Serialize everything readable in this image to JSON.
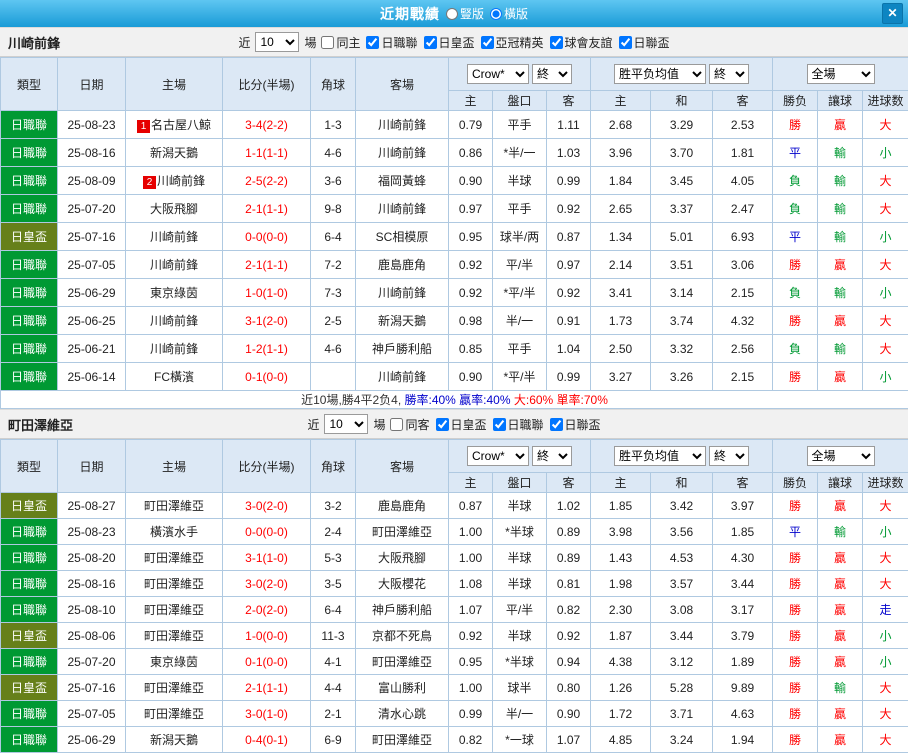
{
  "window": {
    "title": "近期戰績",
    "layout_options": [
      {
        "label": "豎版",
        "selected": false
      },
      {
        "label": "橫版",
        "selected": true
      }
    ],
    "close_icon": "✕"
  },
  "filters": {
    "near_label": "近",
    "match_count": "10",
    "games_label": "場"
  },
  "columns": {
    "type": "類型",
    "date": "日期",
    "home": "主場",
    "score": "比分(半場)",
    "corner": "角球",
    "away": "客場",
    "odds_source": "Crow*",
    "end_label": "終",
    "europe_label": "胜平负均值",
    "scope_label": "全場",
    "sub_home": "主",
    "sub_handicap": "盤口",
    "sub_away": "客",
    "sub_draw": "和",
    "sub_result": "勝负",
    "sub_handicap_result": "讓球",
    "sub_goals": "进球数"
  },
  "colors": {
    "league_green": "#009933",
    "cup_olive": "#66801a",
    "focal_team": "#009933",
    "score_red": "#ff0000",
    "win_red": "#ff0000",
    "draw_blue": "#0000cc",
    "lose_green": "#009933",
    "badge_red": "#e60000"
  },
  "type_colors": {
    "日職聯": "#009933",
    "日皇盃": "#66801a"
  },
  "result_classes": {
    "勝": "r-win",
    "平": "r-draw",
    "負": "r-lose",
    "贏": "r-win",
    "輸": "r-lose",
    "走": "r-draw",
    "大": "r-win",
    "小": "r-lose"
  },
  "sections": [
    {
      "team": "川崎前鋒",
      "checkboxes": [
        {
          "label": "同主",
          "checked": false
        },
        {
          "label": "日職聯",
          "checked": true
        },
        {
          "label": "日皇盃",
          "checked": true
        },
        {
          "label": "亞冠精英",
          "checked": true
        },
        {
          "label": "球會友誼",
          "checked": true
        },
        {
          "label": "日聯盃",
          "checked": true
        }
      ],
      "rows": [
        {
          "type": "日職聯",
          "date": "25-08-23",
          "home": "名古屋八鯨",
          "home_badge": "1",
          "home_focal": false,
          "score": "3-4(2-2)",
          "corner": "1-3",
          "away": "川崎前鋒",
          "away_focal": true,
          "ah_home": "0.79",
          "handicap": "平手",
          "ah_away": "1.11",
          "odds_home": "2.68",
          "odds_draw": "3.29",
          "odds_away": "2.53",
          "result": "勝",
          "handicap_result": "贏",
          "goals_result": "大"
        },
        {
          "type": "日職聯",
          "date": "25-08-16",
          "home": "新潟天鵝",
          "home_badge": "",
          "home_focal": false,
          "score": "1-1(1-1)",
          "corner": "4-6",
          "away": "川崎前鋒",
          "away_focal": true,
          "ah_home": "0.86",
          "handicap": "*半/一",
          "ah_away": "1.03",
          "odds_home": "3.96",
          "odds_draw": "3.70",
          "odds_away": "1.81",
          "result": "平",
          "handicap_result": "輸",
          "goals_result": "小"
        },
        {
          "type": "日職聯",
          "date": "25-08-09",
          "home": "川崎前鋒",
          "home_badge": "2",
          "home_focal": true,
          "score": "2-5(2-2)",
          "corner": "3-6",
          "away": "福岡黃蜂",
          "away_focal": false,
          "ah_home": "0.90",
          "handicap": "半球",
          "ah_away": "0.99",
          "odds_home": "1.84",
          "odds_draw": "3.45",
          "odds_away": "4.05",
          "result": "負",
          "handicap_result": "輸",
          "goals_result": "大"
        },
        {
          "type": "日職聯",
          "date": "25-07-20",
          "home": "大阪飛腳",
          "home_badge": "",
          "home_focal": false,
          "score": "2-1(1-1)",
          "corner": "9-8",
          "away": "川崎前鋒",
          "away_focal": true,
          "ah_home": "0.97",
          "handicap": "平手",
          "ah_away": "0.92",
          "odds_home": "2.65",
          "odds_draw": "3.37",
          "odds_away": "2.47",
          "result": "負",
          "handicap_result": "輸",
          "goals_result": "大"
        },
        {
          "type": "日皇盃",
          "date": "25-07-16",
          "home": "川崎前鋒",
          "home_badge": "",
          "home_focal": true,
          "score": "0-0(0-0)",
          "corner": "6-4",
          "away": "SC相模原",
          "away_focal": false,
          "ah_home": "0.95",
          "handicap": "球半/两",
          "ah_away": "0.87",
          "odds_home": "1.34",
          "odds_draw": "5.01",
          "odds_away": "6.93",
          "result": "平",
          "handicap_result": "輸",
          "goals_result": "小"
        },
        {
          "type": "日職聯",
          "date": "25-07-05",
          "home": "川崎前鋒",
          "home_badge": "",
          "home_focal": true,
          "score": "2-1(1-1)",
          "corner": "7-2",
          "away": "鹿島鹿角",
          "away_focal": false,
          "ah_home": "0.92",
          "handicap": "平/半",
          "ah_away": "0.97",
          "odds_home": "2.14",
          "odds_draw": "3.51",
          "odds_away": "3.06",
          "result": "勝",
          "handicap_result": "贏",
          "goals_result": "大"
        },
        {
          "type": "日職聯",
          "date": "25-06-29",
          "home": "東京綠茵",
          "home_badge": "",
          "home_focal": false,
          "score": "1-0(1-0)",
          "corner": "7-3",
          "away": "川崎前鋒",
          "away_focal": true,
          "ah_home": "0.92",
          "handicap": "*平/半",
          "ah_away": "0.92",
          "odds_home": "3.41",
          "odds_draw": "3.14",
          "odds_away": "2.15",
          "result": "負",
          "handicap_result": "輸",
          "goals_result": "小"
        },
        {
          "type": "日職聯",
          "date": "25-06-25",
          "home": "川崎前鋒",
          "home_badge": "",
          "home_focal": true,
          "score": "3-1(2-0)",
          "corner": "2-5",
          "away": "新潟天鵝",
          "away_focal": false,
          "ah_home": "0.98",
          "handicap": "半/一",
          "ah_away": "0.91",
          "odds_home": "1.73",
          "odds_draw": "3.74",
          "odds_away": "4.32",
          "result": "勝",
          "handicap_result": "贏",
          "goals_result": "大"
        },
        {
          "type": "日職聯",
          "date": "25-06-21",
          "home": "川崎前鋒",
          "home_badge": "",
          "home_focal": true,
          "score": "1-2(1-1)",
          "corner": "4-6",
          "away": "神戶勝利船",
          "away_focal": false,
          "ah_home": "0.85",
          "handicap": "平手",
          "ah_away": "1.04",
          "odds_home": "2.50",
          "odds_draw": "3.32",
          "odds_away": "2.56",
          "result": "負",
          "handicap_result": "輸",
          "goals_result": "大"
        },
        {
          "type": "日職聯",
          "date": "25-06-14",
          "home": "FC橫濱",
          "home_badge": "",
          "home_focal": false,
          "score": "0-1(0-0)",
          "corner": "",
          "away": "川崎前鋒",
          "away_focal": true,
          "ah_home": "0.90",
          "handicap": "*平/半",
          "ah_away": "0.99",
          "odds_home": "3.27",
          "odds_draw": "3.26",
          "odds_away": "2.15",
          "result": "勝",
          "handicap_result": "贏",
          "goals_result": "小"
        }
      ],
      "summary_segments": [
        {
          "text": "近10場,勝4平2负4, ",
          "color": "#333333"
        },
        {
          "text": "勝率:40%",
          "color": "#0000cc"
        },
        {
          "text": " 贏率:40%",
          "color": "#0000cc"
        },
        {
          "text": " 大:60%",
          "color": "#ff0000"
        },
        {
          "text": " 單率:70%",
          "color": "#ff0000"
        }
      ]
    },
    {
      "team": "町田澤維亞",
      "checkboxes": [
        {
          "label": "同客",
          "checked": false
        },
        {
          "label": "日皇盃",
          "checked": true
        },
        {
          "label": "日職聯",
          "checked": true
        },
        {
          "label": "日聯盃",
          "checked": true
        }
      ],
      "rows": [
        {
          "type": "日皇盃",
          "date": "25-08-27",
          "home": "町田澤維亞",
          "home_badge": "",
          "home_focal": true,
          "score": "3-0(2-0)",
          "corner": "3-2",
          "away": "鹿島鹿角",
          "away_focal": false,
          "ah_home": "0.87",
          "handicap": "半球",
          "ah_away": "1.02",
          "odds_home": "1.85",
          "odds_draw": "3.42",
          "odds_away": "3.97",
          "result": "勝",
          "handicap_result": "贏",
          "goals_result": "大"
        },
        {
          "type": "日職聯",
          "date": "25-08-23",
          "home": "橫濱水手",
          "home_badge": "",
          "home_focal": false,
          "score": "0-0(0-0)",
          "corner": "2-4",
          "away": "町田澤維亞",
          "away_focal": true,
          "ah_home": "1.00",
          "handicap": "*半球",
          "ah_away": "0.89",
          "odds_home": "3.98",
          "odds_draw": "3.56",
          "odds_away": "1.85",
          "result": "平",
          "handicap_result": "輸",
          "goals_result": "小"
        },
        {
          "type": "日職聯",
          "date": "25-08-20",
          "home": "町田澤維亞",
          "home_badge": "",
          "home_focal": true,
          "score": "3-1(1-0)",
          "corner": "5-3",
          "away": "大阪飛腳",
          "away_focal": false,
          "ah_home": "1.00",
          "handicap": "半球",
          "ah_away": "0.89",
          "odds_home": "1.43",
          "odds_draw": "4.53",
          "odds_away": "4.30",
          "result": "勝",
          "handicap_result": "贏",
          "goals_result": "大"
        },
        {
          "type": "日職聯",
          "date": "25-08-16",
          "home": "町田澤維亞",
          "home_badge": "",
          "home_focal": true,
          "score": "3-0(2-0)",
          "corner": "3-5",
          "away": "大阪櫻花",
          "away_focal": false,
          "ah_home": "1.08",
          "handicap": "半球",
          "ah_away": "0.81",
          "odds_home": "1.98",
          "odds_draw": "3.57",
          "odds_away": "3.44",
          "result": "勝",
          "handicap_result": "贏",
          "goals_result": "大"
        },
        {
          "type": "日職聯",
          "date": "25-08-10",
          "home": "町田澤維亞",
          "home_badge": "",
          "home_focal": true,
          "score": "2-0(2-0)",
          "corner": "6-4",
          "away": "神戶勝利船",
          "away_focal": false,
          "ah_home": "1.07",
          "handicap": "平/半",
          "ah_away": "0.82",
          "odds_home": "2.30",
          "odds_draw": "3.08",
          "odds_away": "3.17",
          "result": "勝",
          "handicap_result": "贏",
          "goals_result": "走"
        },
        {
          "type": "日皇盃",
          "date": "25-08-06",
          "home": "町田澤維亞",
          "home_badge": "",
          "home_focal": true,
          "score": "1-0(0-0)",
          "corner": "11-3",
          "away": "京都不死鳥",
          "away_focal": false,
          "ah_home": "0.92",
          "handicap": "半球",
          "ah_away": "0.92",
          "odds_home": "1.87",
          "odds_draw": "3.44",
          "odds_away": "3.79",
          "result": "勝",
          "handicap_result": "贏",
          "goals_result": "小"
        },
        {
          "type": "日職聯",
          "date": "25-07-20",
          "home": "東京綠茵",
          "home_badge": "",
          "home_focal": false,
          "score": "0-1(0-0)",
          "corner": "4-1",
          "away": "町田澤維亞",
          "away_focal": true,
          "ah_home": "0.95",
          "handicap": "*半球",
          "ah_away": "0.94",
          "odds_home": "4.38",
          "odds_draw": "3.12",
          "odds_away": "1.89",
          "result": "勝",
          "handicap_result": "贏",
          "goals_result": "小"
        },
        {
          "type": "日皇盃",
          "date": "25-07-16",
          "home": "町田澤維亞",
          "home_badge": "",
          "home_focal": true,
          "score": "2-1(1-1)",
          "corner": "4-4",
          "away": "富山勝利",
          "away_focal": false,
          "ah_home": "1.00",
          "handicap": "球半",
          "ah_away": "0.80",
          "odds_home": "1.26",
          "odds_draw": "5.28",
          "odds_away": "9.89",
          "result": "勝",
          "handicap_result": "輸",
          "goals_result": "大"
        },
        {
          "type": "日職聯",
          "date": "25-07-05",
          "home": "町田澤維亞",
          "home_badge": "",
          "home_focal": true,
          "score": "3-0(1-0)",
          "corner": "2-1",
          "away": "清水心跳",
          "away_focal": false,
          "ah_home": "0.99",
          "handicap": "半/一",
          "ah_away": "0.90",
          "odds_home": "1.72",
          "odds_draw": "3.71",
          "odds_away": "4.63",
          "result": "勝",
          "handicap_result": "贏",
          "goals_result": "大"
        },
        {
          "type": "日職聯",
          "date": "25-06-29",
          "home": "新潟天鵝",
          "home_badge": "",
          "home_focal": false,
          "score": "0-4(0-1)",
          "corner": "6-9",
          "away": "町田澤維亞",
          "away_focal": true,
          "ah_home": "0.82",
          "handicap": "*一球",
          "ah_away": "1.07",
          "odds_home": "4.85",
          "odds_draw": "3.24",
          "odds_away": "1.94",
          "result": "勝",
          "handicap_result": "贏",
          "goals_result": "大"
        }
      ],
      "summary_segments": null
    }
  ]
}
